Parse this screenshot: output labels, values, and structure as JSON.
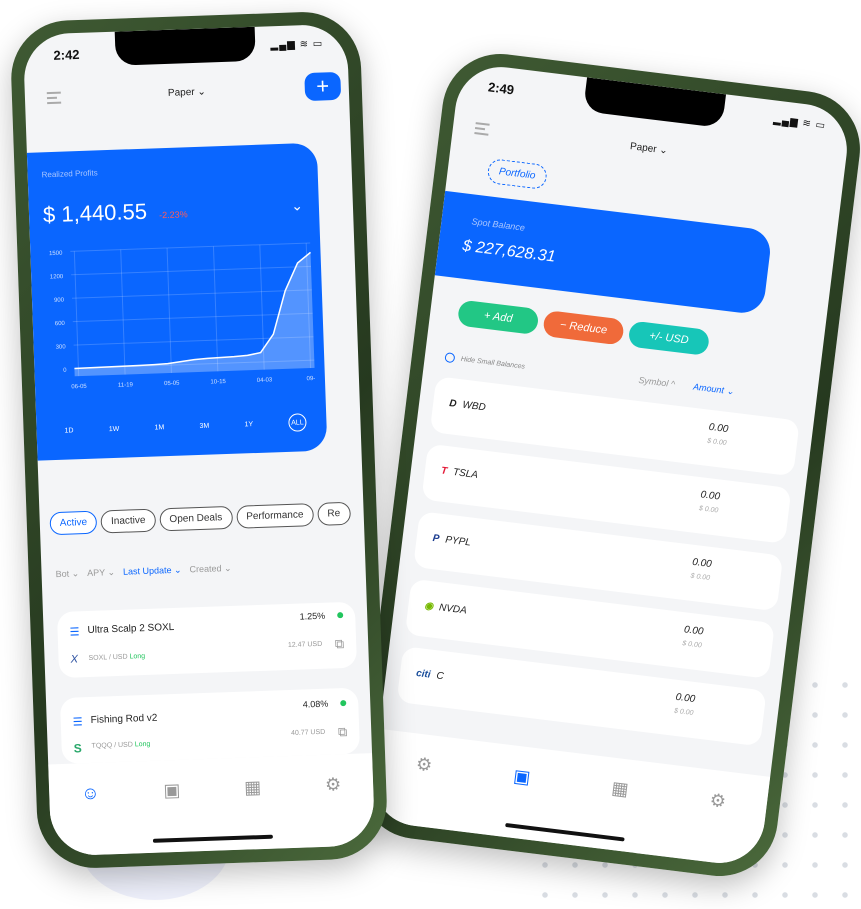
{
  "left_phone": {
    "time": "2:42",
    "account": "Paper ⌄",
    "plus_label": "+",
    "card": {
      "label": "Realized Profits",
      "value": "$ 1,440.55",
      "change": "-2.23%",
      "change_color": "#ff5a5a",
      "periods": [
        "1D",
        "1W",
        "1M",
        "3M",
        "1Y",
        "ALL"
      ],
      "selected_period": "ALL"
    },
    "tabs": [
      "Active",
      "Inactive",
      "Open Deals",
      "Performance",
      "Re"
    ],
    "sort": [
      "Bot ⌄",
      "APY ⌄",
      "Last Update ⌄",
      "Created ⌄"
    ],
    "bots": [
      {
        "name": "Ultra Scalp 2 SOXL",
        "pair": "SOXL / USD",
        "side": "Long",
        "pct": "1.25%",
        "value": "12.47 USD"
      },
      {
        "name": "Fishing Rod v2",
        "pair": "TQQQ / USD",
        "side": "Long",
        "pct": "4.08%",
        "value": "40.77 USD"
      }
    ],
    "nav_icons": [
      "robot-icon",
      "wallet-icon",
      "store-icon",
      "gear-icon"
    ]
  },
  "chart_data": {
    "type": "area",
    "x_tick_labels": [
      "06-05",
      "11-19",
      "05-05",
      "10-15",
      "04-03",
      "09-"
    ],
    "y_ticks": [
      0,
      300,
      600,
      900,
      1200,
      1500
    ],
    "ylim": [
      -100,
      1500
    ],
    "values": [
      0,
      2,
      4,
      6,
      8,
      10,
      14,
      20,
      40,
      60,
      70,
      75,
      80,
      90,
      120,
      350,
      900,
      1250,
      1380
    ],
    "grid": true
  },
  "right_phone": {
    "time": "2:49",
    "account": "Paper ⌄",
    "portfolio_label": "Portfolio",
    "card": {
      "label": "Spot Balance",
      "value": "$ 227,628.31"
    },
    "buttons": {
      "add": "+ Add",
      "reduce": "− Reduce",
      "usd": "+/- USD"
    },
    "hide_small": "Hide Small Balances",
    "symbol_sort": "Symbol ^",
    "amount_sort": "Amount ⌄",
    "assets": [
      {
        "symbol": "WBD",
        "amount": "0.00",
        "usd": "$ 0.00"
      },
      {
        "symbol": "TSLA",
        "amount": "0.00",
        "usd": "$ 0.00"
      },
      {
        "symbol": "PYPL",
        "amount": "0.00",
        "usd": "$ 0.00"
      },
      {
        "symbol": "NVDA",
        "amount": "0.00",
        "usd": "$ 0.00"
      },
      {
        "symbol": "C",
        "amount": "0.00",
        "usd": "$ 0.00"
      }
    ]
  },
  "colors": {
    "accent": "#0a66ff",
    "add": "#22c785",
    "reduce": "#f06a3a",
    "usd": "#17c6b8",
    "positive": "#22c55e"
  }
}
